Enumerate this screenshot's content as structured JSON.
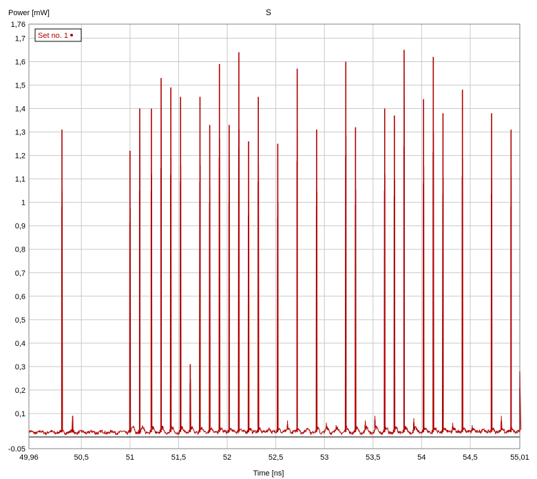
{
  "chart_data": {
    "type": "line",
    "title": "S",
    "xlabel": "Time [ns]",
    "ylabel": "Power [mW]",
    "xlim": [
      49.96,
      55.01
    ],
    "ylim": [
      -0.05,
      1.76
    ],
    "x_ticks": [
      49.96,
      50.5,
      51,
      51.5,
      52,
      52.5,
      53,
      53.5,
      54,
      54.5,
      55.01
    ],
    "x_tick_labels": [
      "49,96",
      "50,5",
      "51",
      "51,5",
      "52",
      "52,5",
      "53",
      "53,5",
      "54",
      "54,5",
      "55,01"
    ],
    "y_ticks": [
      -0.05,
      0.1,
      0.2,
      0.3,
      0.4,
      0.5,
      0.6,
      0.7,
      0.8,
      0.9,
      1,
      1.1,
      1.2,
      1.3,
      1.4,
      1.5,
      1.6,
      1.7,
      1.76
    ],
    "y_tick_labels": [
      "-0.05",
      "0,1",
      "0,2",
      "0,3",
      "0,4",
      "0,5",
      "0,6",
      "0,7",
      "0,8",
      "0,9",
      "1",
      "1,1",
      "1,2",
      "1,3",
      "1,4",
      "1,5",
      "1,6",
      "1,7",
      "1,76"
    ],
    "grid": true,
    "legend_position": "top-left",
    "baseline": 0.02,
    "series": [
      {
        "name": "Set no. 1",
        "color": "#b00000",
        "peaks": [
          {
            "x": 50.3,
            "y": 1.31
          },
          {
            "x": 50.41,
            "y": 0.09
          },
          {
            "x": 51.0,
            "y": 1.22
          },
          {
            "x": 51.1,
            "y": 1.4
          },
          {
            "x": 51.22,
            "y": 1.4
          },
          {
            "x": 51.32,
            "y": 1.53
          },
          {
            "x": 51.42,
            "y": 1.49
          },
          {
            "x": 51.52,
            "y": 1.45
          },
          {
            "x": 51.62,
            "y": 0.31
          },
          {
            "x": 51.72,
            "y": 1.45
          },
          {
            "x": 51.82,
            "y": 1.33
          },
          {
            "x": 51.92,
            "y": 1.59
          },
          {
            "x": 52.02,
            "y": 1.33
          },
          {
            "x": 52.12,
            "y": 1.64
          },
          {
            "x": 52.22,
            "y": 1.26
          },
          {
            "x": 52.32,
            "y": 1.45
          },
          {
            "x": 52.52,
            "y": 1.25
          },
          {
            "x": 52.72,
            "y": 1.57
          },
          {
            "x": 52.92,
            "y": 1.31
          },
          {
            "x": 53.22,
            "y": 1.6
          },
          {
            "x": 53.32,
            "y": 1.32
          },
          {
            "x": 53.62,
            "y": 1.4
          },
          {
            "x": 53.72,
            "y": 1.37
          },
          {
            "x": 53.82,
            "y": 1.65
          },
          {
            "x": 54.02,
            "y": 1.44
          },
          {
            "x": 54.12,
            "y": 1.62
          },
          {
            "x": 54.22,
            "y": 1.38
          },
          {
            "x": 54.42,
            "y": 1.48
          },
          {
            "x": 54.72,
            "y": 1.38
          },
          {
            "x": 54.92,
            "y": 1.31
          },
          {
            "x": 55.01,
            "y": 0.28
          }
        ],
        "small_bumps": [
          {
            "x": 52.52,
            "y": 0.06
          },
          {
            "x": 52.62,
            "y": 0.07
          },
          {
            "x": 53.02,
            "y": 0.06
          },
          {
            "x": 53.12,
            "y": 0.05
          },
          {
            "x": 53.42,
            "y": 0.07
          },
          {
            "x": 53.52,
            "y": 0.09
          },
          {
            "x": 53.92,
            "y": 0.08
          },
          {
            "x": 54.32,
            "y": 0.06
          },
          {
            "x": 54.52,
            "y": 0.05
          },
          {
            "x": 54.82,
            "y": 0.09
          }
        ]
      }
    ]
  }
}
